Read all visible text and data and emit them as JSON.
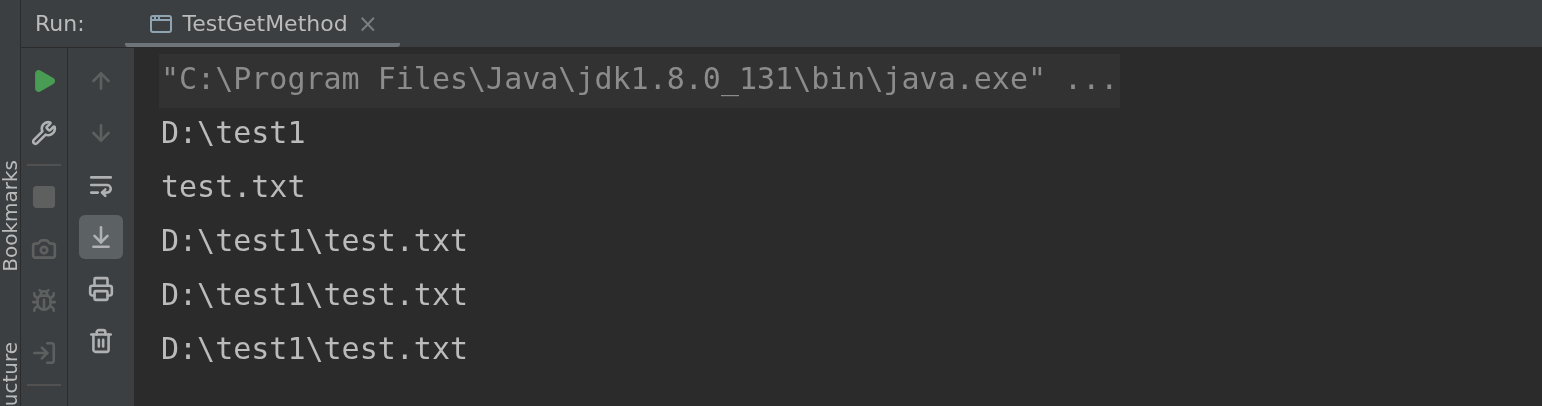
{
  "side_strip": {
    "items": [
      {
        "label": "Bookmarks"
      },
      {
        "label": "ucture"
      }
    ]
  },
  "header": {
    "label": "Run:",
    "tabs": [
      {
        "label": "TestGetMethod",
        "selected": true,
        "close": "×"
      }
    ]
  },
  "toolbar_left": [
    {
      "kind": "run",
      "disabled": false
    },
    {
      "kind": "wrench",
      "disabled": false
    },
    {
      "kind": "separator"
    },
    {
      "kind": "stop",
      "disabled": true
    },
    {
      "kind": "camera",
      "disabled": true
    },
    {
      "kind": "debug",
      "disabled": true
    },
    {
      "kind": "login",
      "disabled": true
    },
    {
      "kind": "separator"
    }
  ],
  "toolbar_right": [
    {
      "kind": "up",
      "disabled": true,
      "selected": false
    },
    {
      "kind": "down",
      "disabled": true,
      "selected": false
    },
    {
      "kind": "wrap",
      "disabled": false,
      "selected": false
    },
    {
      "kind": "scroll-end",
      "disabled": false,
      "selected": true
    },
    {
      "kind": "print",
      "disabled": false,
      "selected": false
    },
    {
      "kind": "trash",
      "disabled": false,
      "selected": false
    }
  ],
  "console": {
    "lines": [
      {
        "text": "\"C:\\Program Files\\Java\\jdk1.8.0_131\\bin\\java.exe\" ...",
        "kind": "command"
      },
      {
        "text": "D:\\test1",
        "kind": "output"
      },
      {
        "text": "test.txt",
        "kind": "output"
      },
      {
        "text": "D:\\test1\\test.txt",
        "kind": "output"
      },
      {
        "text": "D:\\test1\\test.txt",
        "kind": "output"
      },
      {
        "text": "D:\\test1\\test.txt",
        "kind": "output"
      }
    ]
  }
}
